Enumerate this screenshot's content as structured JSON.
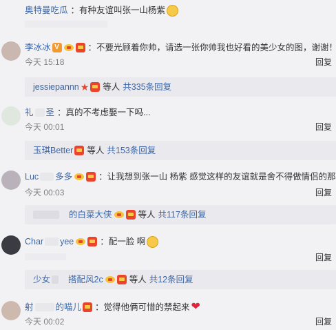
{
  "comments": [
    {
      "name": "奥特曼吃瓜",
      "text": "：有种友谊叫张一山杨紫",
      "time": "",
      "reply": ""
    },
    {
      "name": "李冰冰",
      "text": "：不要光顾着你帅，请选一张你帅我也好看的美少女的图，谢谢！",
      "time": "今天 15:18",
      "reply": "回复",
      "sub": {
        "name": "jessiepannn",
        "etc": "等人",
        "count": "共335条回复"
      }
    },
    {
      "name": "礼",
      "name_tail": "圣",
      "text": "：真的不考虑娶一下吗...",
      "time": "今天 00:01",
      "reply": "回复",
      "sub": {
        "name": "玉琪Better",
        "etc": "等人",
        "count": "共153条回复"
      }
    },
    {
      "name": "Luc",
      "name_tail": "多多",
      "text": "：让我想到张一山 杨紫 感觉这样的友谊就是舍不得做情侣的那种",
      "time": "今天 00:03",
      "reply": "回复",
      "sub": {
        "name": "的白菜大侠",
        "name_head": "​",
        "etc": "等人",
        "count": "共117条回复"
      }
    },
    {
      "name": "Char",
      "name_tail": "yee",
      "text": "：配一脸 啊",
      "time": "",
      "reply": "回复",
      "sub": {
        "name": "少女",
        "name_tail": "搭配风2c",
        "etc": "等人",
        "count": "共12条回复"
      }
    },
    {
      "name": "射",
      "name_tail": "的喵儿",
      "text": "：觉得他俩可惜的禁起来",
      "time": "今天 00:02",
      "reply": "回复"
    }
  ],
  "colors": {
    "background": "#f2f2f5",
    "username": "#3a66a8",
    "reply_box": "#e9e9ee",
    "badge_red": "#e8452c",
    "heart": "#e0243c"
  },
  "icons": {
    "badge": "red-envelope-badge-icon",
    "vip": "v-verified-icon",
    "crown": "crown-medal-icon",
    "star": "red-star-icon",
    "emoji": "smile-emoji-icon",
    "heart": "heart-icon"
  },
  "vip_label": "V",
  "star_glyph": "★",
  "heart_glyph": "❤"
}
